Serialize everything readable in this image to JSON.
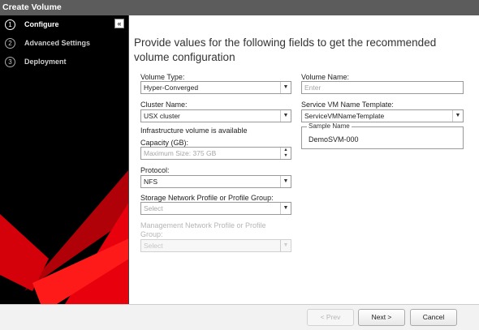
{
  "window": {
    "title": "Create Volume"
  },
  "colors": {
    "sidebar_bg": "#000000",
    "accent_red": "#e8000c",
    "titlebar": "#5c5c5c"
  },
  "sidebar": {
    "collapse_icon": "«",
    "steps": [
      {
        "number": "1",
        "label": "Configure",
        "active": true
      },
      {
        "number": "2",
        "label": "Advanced Settings",
        "active": false
      },
      {
        "number": "3",
        "label": "Deployment",
        "active": false
      }
    ]
  },
  "main": {
    "heading": "Provide values for the following fields to get the recommended volume configuration",
    "volume_type": {
      "label": "Volume Type:",
      "value": "Hyper-Converged"
    },
    "cluster_name": {
      "label": "Cluster Name:",
      "value": "USX cluster"
    },
    "infra_note": "Infrastructure volume is available",
    "capacity": {
      "label": "Capacity (GB):",
      "placeholder": "Maximum Size: 375 GB"
    },
    "protocol": {
      "label": "Protocol:",
      "value": "NFS"
    },
    "storage_network": {
      "label": "Storage Network Profile or Profile Group:",
      "placeholder": "Select"
    },
    "management_network": {
      "label": "Management Network Profile or Profile Group:",
      "placeholder": "Select"
    },
    "volume_name": {
      "label": "Volume Name:",
      "placeholder": "Enter"
    },
    "service_vm_template": {
      "label": "Service VM Name Template:",
      "value": "ServiceVMNameTemplate"
    },
    "sample_name": {
      "legend": "Sample Name",
      "value": "DemoSVM-000"
    }
  },
  "footer": {
    "prev": "< Prev",
    "next": "Next >",
    "cancel": "Cancel"
  }
}
